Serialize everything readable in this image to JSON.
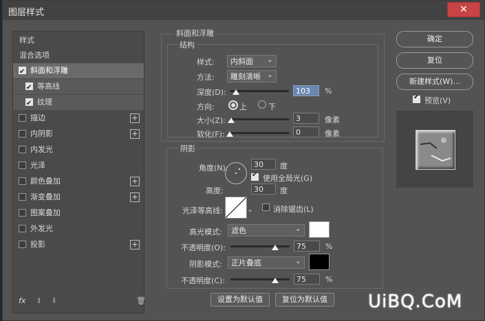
{
  "window": {
    "title": "图层样式",
    "close": "✕"
  },
  "sidebar": {
    "items": [
      {
        "label": "样式"
      },
      {
        "label": "混合选项"
      },
      {
        "label": "斜面和浮雕"
      },
      {
        "label": "等高线"
      },
      {
        "label": "纹理"
      },
      {
        "label": "描边"
      },
      {
        "label": "内阴影"
      },
      {
        "label": "内发光"
      },
      {
        "label": "光泽"
      },
      {
        "label": "颜色叠加"
      },
      {
        "label": "渐变叠加"
      },
      {
        "label": "图案叠加"
      },
      {
        "label": "外发光"
      },
      {
        "label": "投影"
      }
    ],
    "footer": {
      "fx": "fx",
      "up": "⬆",
      "down": "⬇",
      "trash": "🗑"
    }
  },
  "bevel": {
    "section_title": "斜面和浮雕",
    "structure_title": "结构",
    "style_label": "样式:",
    "style_value": "内斜面",
    "technique_label": "方法:",
    "technique_value": "雕刻清晰",
    "depth_label": "深度(D):",
    "depth_value": "103",
    "depth_unit": "%",
    "depth_fraction": 0.1,
    "direction_label": "方向:",
    "dir_up": "上",
    "dir_down": "下",
    "size_label": "大小(Z):",
    "size_value": "3",
    "size_unit": "像素",
    "size_fraction": 0.02,
    "soften_label": "软化(F):",
    "soften_value": "0",
    "soften_unit": "像素",
    "soften_fraction": 0.0
  },
  "shading": {
    "title": "阴影",
    "angle_label": "角度(N):",
    "angle_value": "30",
    "angle_unit": "度",
    "global_light": "使用全局光(G)",
    "altitude_label": "高度:",
    "altitude_value": "30",
    "altitude_unit": "度",
    "gloss_label": "光泽等高线:",
    "antialias": "消除锯齿(L)",
    "highlight_label": "高光模式:",
    "highlight_mode": "滤色",
    "highlight_color": "#ffffff",
    "opacity1_label": "不透明度(O):",
    "opacity1_value": "75",
    "opacity1_unit": "%",
    "opacity1_fraction": 0.75,
    "shadow_label": "阴影模式:",
    "shadow_mode": "正片叠底",
    "shadow_color": "#000000",
    "opacity2_label": "不透明度(C):",
    "opacity2_value": "75",
    "opacity2_unit": "%",
    "opacity2_fraction": 0.75
  },
  "bottom_buttons": {
    "set_default": "设置为默认值",
    "reset_default": "复位为默认值"
  },
  "right_buttons": {
    "ok": "确定",
    "reset": "复位",
    "new_style": "新建样式(W)...",
    "preview": "预览(V)"
  },
  "watermark": "UiBQ.CoM"
}
